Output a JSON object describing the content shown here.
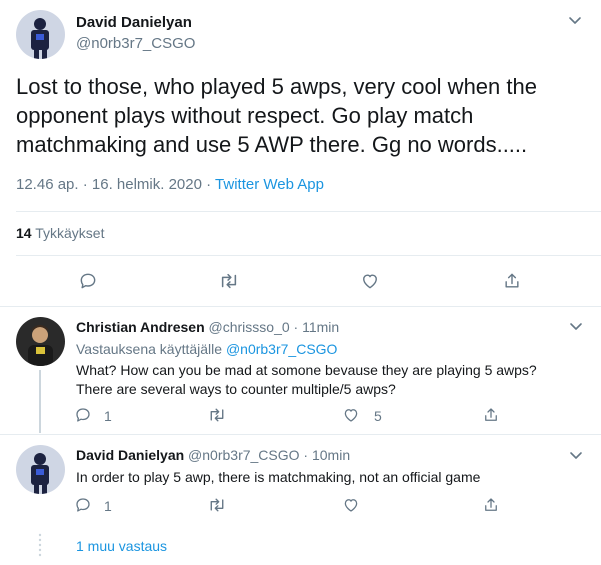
{
  "main_tweet": {
    "author_name": "David Danielyan",
    "author_handle": "@n0rb3r7_CSGO",
    "text_line1": "Lost to those, who played 5 awps, very cool when the",
    "text_line2": "opponent plays without respect. Go play match",
    "text_line3": "matchmaking and use 5 AWP there. Gg no words.....",
    "timestamp": "12.46 ap. · 16. helmik. 2020 ·",
    "source": "Twitter Web App",
    "likes_count": "14",
    "likes_label": "Tykkäykset"
  },
  "reply1": {
    "author_name": "Christian Andresen",
    "author_handle": "@chrissso_0",
    "time": "· 11min",
    "replying_prefix": "Vastauksena käyttäjälle",
    "replying_to": "@n0rb3r7_CSGO",
    "text_line1": "What? How can you be mad at somone bevause they are playing 5 awps?",
    "text_line2": "There are several ways to counter multiple/5 awps?",
    "reply_count": "1",
    "like_count": "5"
  },
  "reply2": {
    "author_name": "David Danielyan",
    "author_handle": "@n0rb3r7_CSGO",
    "time": "· 10min",
    "text": "In order to play 5 awp, there is matchmaking, not an official game",
    "reply_count": "1"
  },
  "more_replies": "1 muu vastaus",
  "icons": {
    "chevron": "chevron-down-icon",
    "reply": "reply-icon",
    "retweet": "retweet-icon",
    "like": "heart-icon",
    "share": "share-icon"
  },
  "colors": {
    "accent": "#1b95e0",
    "muted": "#657786",
    "divider": "#e6ecf0",
    "thread_line": "#ccd6dd"
  }
}
